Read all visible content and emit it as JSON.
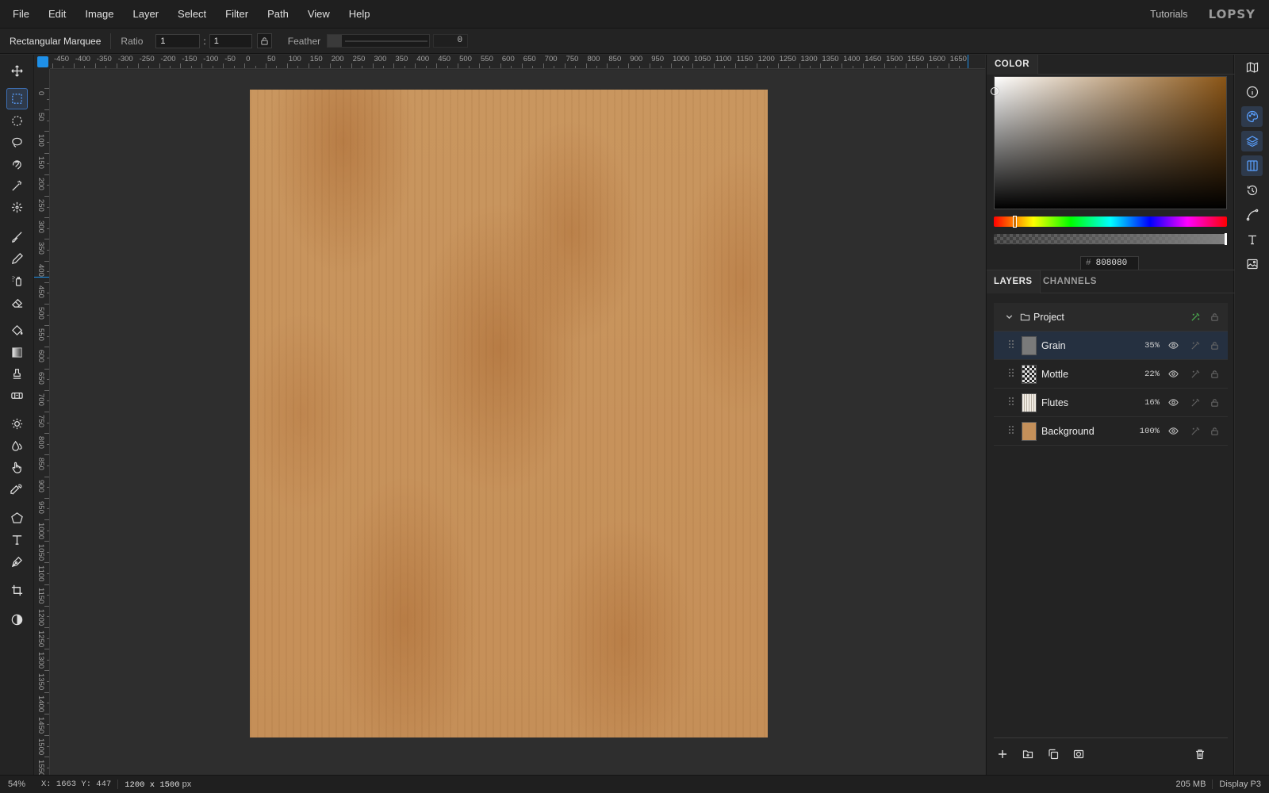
{
  "menu": [
    "File",
    "Edit",
    "Image",
    "Layer",
    "Select",
    "Filter",
    "Path",
    "View",
    "Help"
  ],
  "header_right": {
    "tutorials": "Tutorials",
    "logo": "LOPSY"
  },
  "options": {
    "tool_name": "Rectangular Marquee",
    "ratio_label": "Ratio",
    "ratio_w": "1",
    "ratio_sep": ":",
    "ratio_h": "1",
    "feather_label": "Feather",
    "feather_value": "0"
  },
  "ruler_top": [
    "-450",
    "-400",
    "-350",
    "-300",
    "-250",
    "-200",
    "-150",
    "-100",
    "-50",
    "0",
    "50",
    "100",
    "150",
    "200",
    "250",
    "300",
    "350",
    "400",
    "450",
    "500",
    "550",
    "600",
    "650",
    "700",
    "750",
    "800",
    "850",
    "900",
    "950",
    "1000",
    "1050",
    "1100",
    "1150",
    "1200",
    "1250",
    "1300",
    "1350",
    "1400",
    "1450",
    "1500",
    "1550",
    "1600",
    "1650"
  ],
  "ruler_left": [
    "0",
    "50",
    "100",
    "150",
    "200",
    "250",
    "300",
    "350",
    "400",
    "450",
    "500",
    "550",
    "600",
    "650",
    "700",
    "750",
    "800",
    "850",
    "900",
    "950",
    "1000",
    "1050",
    "1100",
    "1150",
    "1200",
    "1250",
    "1300",
    "1350",
    "1400",
    "1450",
    "1500",
    "1550"
  ],
  "color_panel": {
    "tab": "COLOR",
    "hash": "#",
    "hex": "808080"
  },
  "layers_panel": {
    "tabs": [
      "LAYERS",
      "CHANNELS"
    ],
    "group": {
      "name": "Project"
    },
    "layers": [
      {
        "name": "Grain",
        "opacity": "35%",
        "selected": true,
        "thumb": "#7a7a7a"
      },
      {
        "name": "Mottle",
        "opacity": "22%",
        "selected": false,
        "thumb": "mottle"
      },
      {
        "name": "Flutes",
        "opacity": "16%",
        "selected": false,
        "thumb": "flutes"
      },
      {
        "name": "Background",
        "opacity": "100%",
        "selected": false,
        "thumb": "#c4905a"
      }
    ]
  },
  "status": {
    "zoom": "54%",
    "xy": "X: 1663 Y: 447",
    "dimensions_value": "1200 x 1500",
    "dimensions_unit": "px",
    "memory": "205 MB",
    "profile": "Display P3"
  },
  "colors": {
    "accent": "#1e90e8",
    "selection": "#253040",
    "doc": "#c8945c"
  }
}
